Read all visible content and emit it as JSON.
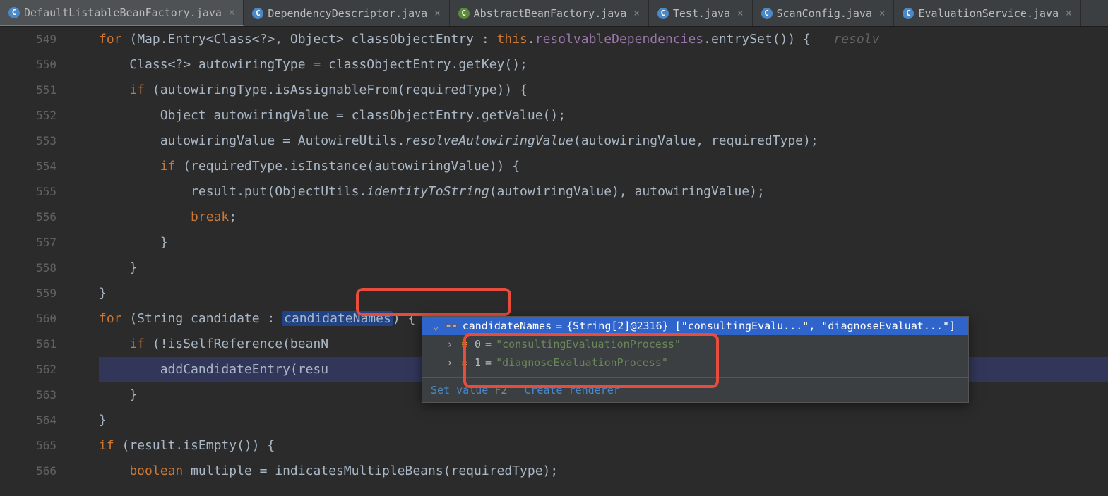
{
  "tabs": [
    {
      "label": "DefaultListableBeanFactory.java",
      "icon": "c",
      "active": true
    },
    {
      "label": "DependencyDescriptor.java",
      "icon": "c",
      "active": false
    },
    {
      "label": "AbstractBeanFactory.java",
      "icon": "i",
      "active": false
    },
    {
      "label": "Test.java",
      "icon": "c",
      "active": false
    },
    {
      "label": "ScanConfig.java",
      "icon": "c",
      "active": false
    },
    {
      "label": "EvaluationService.java",
      "icon": "c",
      "active": false
    }
  ],
  "gutter": {
    "549": "549",
    "550": "550",
    "551": "551",
    "552": "552",
    "553": "553",
    "554": "554",
    "555": "555",
    "556": "556",
    "557": "557",
    "558": "558",
    "559": "559",
    "560": "560",
    "561": "561",
    "562": "562",
    "563": "563",
    "564": "564",
    "565": "565",
    "566": "566"
  },
  "code": {
    "l549": {
      "for": "for",
      "text1": " (Map.Entry<Class<?>, Object> classObjectEntry : ",
      "this": "this",
      "dot": ".",
      "field": "resolvableDependencies",
      "text2": ".entrySet()) {",
      "hint": "   resolv"
    },
    "l550": "    Class<?> autowiringType = classObjectEntry.getKey();",
    "l551": {
      "if": "    if",
      "text": " (autowiringType.isAssignableFrom(requiredType)) {"
    },
    "l552": "        Object autowiringValue = classObjectEntry.getValue();",
    "l553": {
      "text1": "        autowiringValue = AutowireUtils.",
      "method": "resolveAutowiringValue",
      "text2": "(autowiringValue, requiredType);"
    },
    "l554": {
      "if": "        if",
      "text": " (requiredType.isInstance(autowiringValue)) {"
    },
    "l555": {
      "text1": "            result.put(ObjectUtils.",
      "method": "identityToString",
      "text2": "(autowiringValue), autowiringValue);"
    },
    "l556": {
      "break": "            break",
      "semi": ";"
    },
    "l557": "        }",
    "l558": "    }",
    "l559": "}",
    "l560": {
      "for": "for",
      "text1": " (String candidate : ",
      "var": "candidateNames",
      "text2": ") {"
    },
    "l561": {
      "if": "    if",
      "text": " (!isSelfReference(beanN",
      "tail": ")) {"
    },
    "l562": "        addCandidateEntry(resu",
    "l563": "    }",
    "l564": "}",
    "l565": {
      "if": "if",
      "text": " (result.isEmpty()) {"
    },
    "l566": {
      "bool": "    boolean",
      "text": " multiple = indicatesMultipleBeans(requiredType);"
    }
  },
  "popup": {
    "headerVar": "candidateNames",
    "headerEq": " = ",
    "headerVal": "{String[2]@2316} [\"consultingEvalu...\", \"diagnoseEvaluat...\"]",
    "item0_idx": "0",
    "item0_eq": " = ",
    "item0_val": "\"consultingEvaluationProcess\"",
    "item1_idx": "1",
    "item1_eq": " = ",
    "item1_val": "\"diagnoseEvaluationProcess\"",
    "setValue": "Set value",
    "shortcut": "F2",
    "createRenderer": "Create renderer"
  }
}
